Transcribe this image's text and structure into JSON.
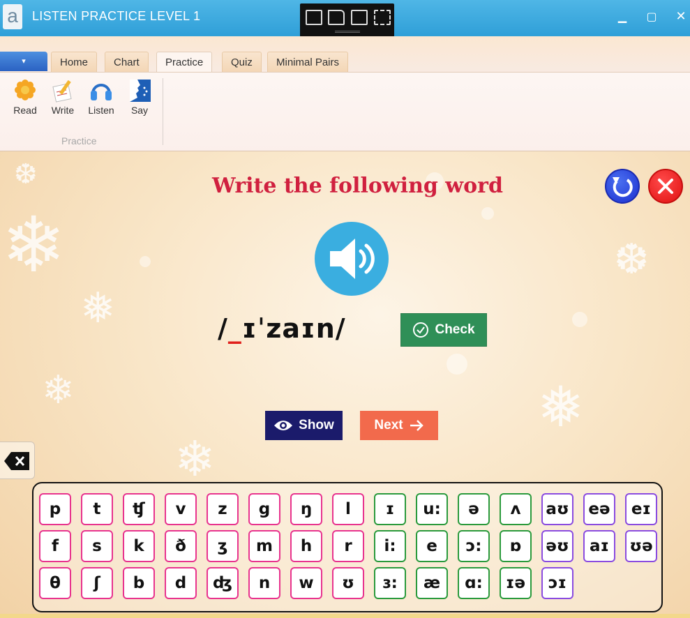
{
  "window": {
    "title": "LISTEN PRACTICE LEVEL 1",
    "app_icon_letter": "a",
    "minimize": "▁",
    "maximize": "▢",
    "close": "✕"
  },
  "ribbon": {
    "file_menu": "▾",
    "tabs": [
      {
        "label": "Home"
      },
      {
        "label": "Chart"
      },
      {
        "label": "Practice"
      },
      {
        "label": "Quiz"
      },
      {
        "label": "Minimal Pairs"
      }
    ],
    "active_tab": "Practice",
    "group_label": "Practice",
    "buttons": [
      {
        "label": "Read",
        "icon": "flower-icon"
      },
      {
        "label": "Write",
        "icon": "pencil-paper-icon"
      },
      {
        "label": "Listen",
        "icon": "headphones-icon"
      },
      {
        "label": "Say",
        "icon": "speaking-head-icon"
      }
    ]
  },
  "exercise": {
    "heading": "Write the following word",
    "transcription_prefix": "/",
    "blank": "_",
    "transcription_rest": "ɪˈzaɪn/",
    "check_label": "Check",
    "show_label": "Show",
    "next_label": "Next"
  },
  "keyboard": {
    "rows": [
      [
        "p",
        "t",
        "ʧ",
        "v",
        "z",
        "g",
        "ŋ",
        "l",
        "ɪ",
        "u:",
        "ə",
        "ʌ",
        "aʊ",
        "eə",
        "eɪ"
      ],
      [
        "f",
        "s",
        "k",
        "ð",
        "ʒ",
        "m",
        "h",
        "r",
        "i:",
        "e",
        "ɔ:",
        "ɒ",
        "əʊ",
        "aɪ",
        "ʊə"
      ],
      [
        "θ",
        "ʃ",
        "b",
        "d",
        "ʤ",
        "n",
        "w",
        "ʊ",
        "ɜ:",
        "æ",
        "ɑ:",
        "ɪə",
        "ɔɪ"
      ]
    ]
  },
  "colors": {
    "heading": "#d0203f",
    "consonant_border": "#e8338e",
    "vowel_border": "#2a9a3c",
    "diphthong_border": "#8a4be0",
    "check": "#2f8f57",
    "show": "#1b1b6b",
    "next": "#f26a4c",
    "speaker": "#3aaee0"
  }
}
